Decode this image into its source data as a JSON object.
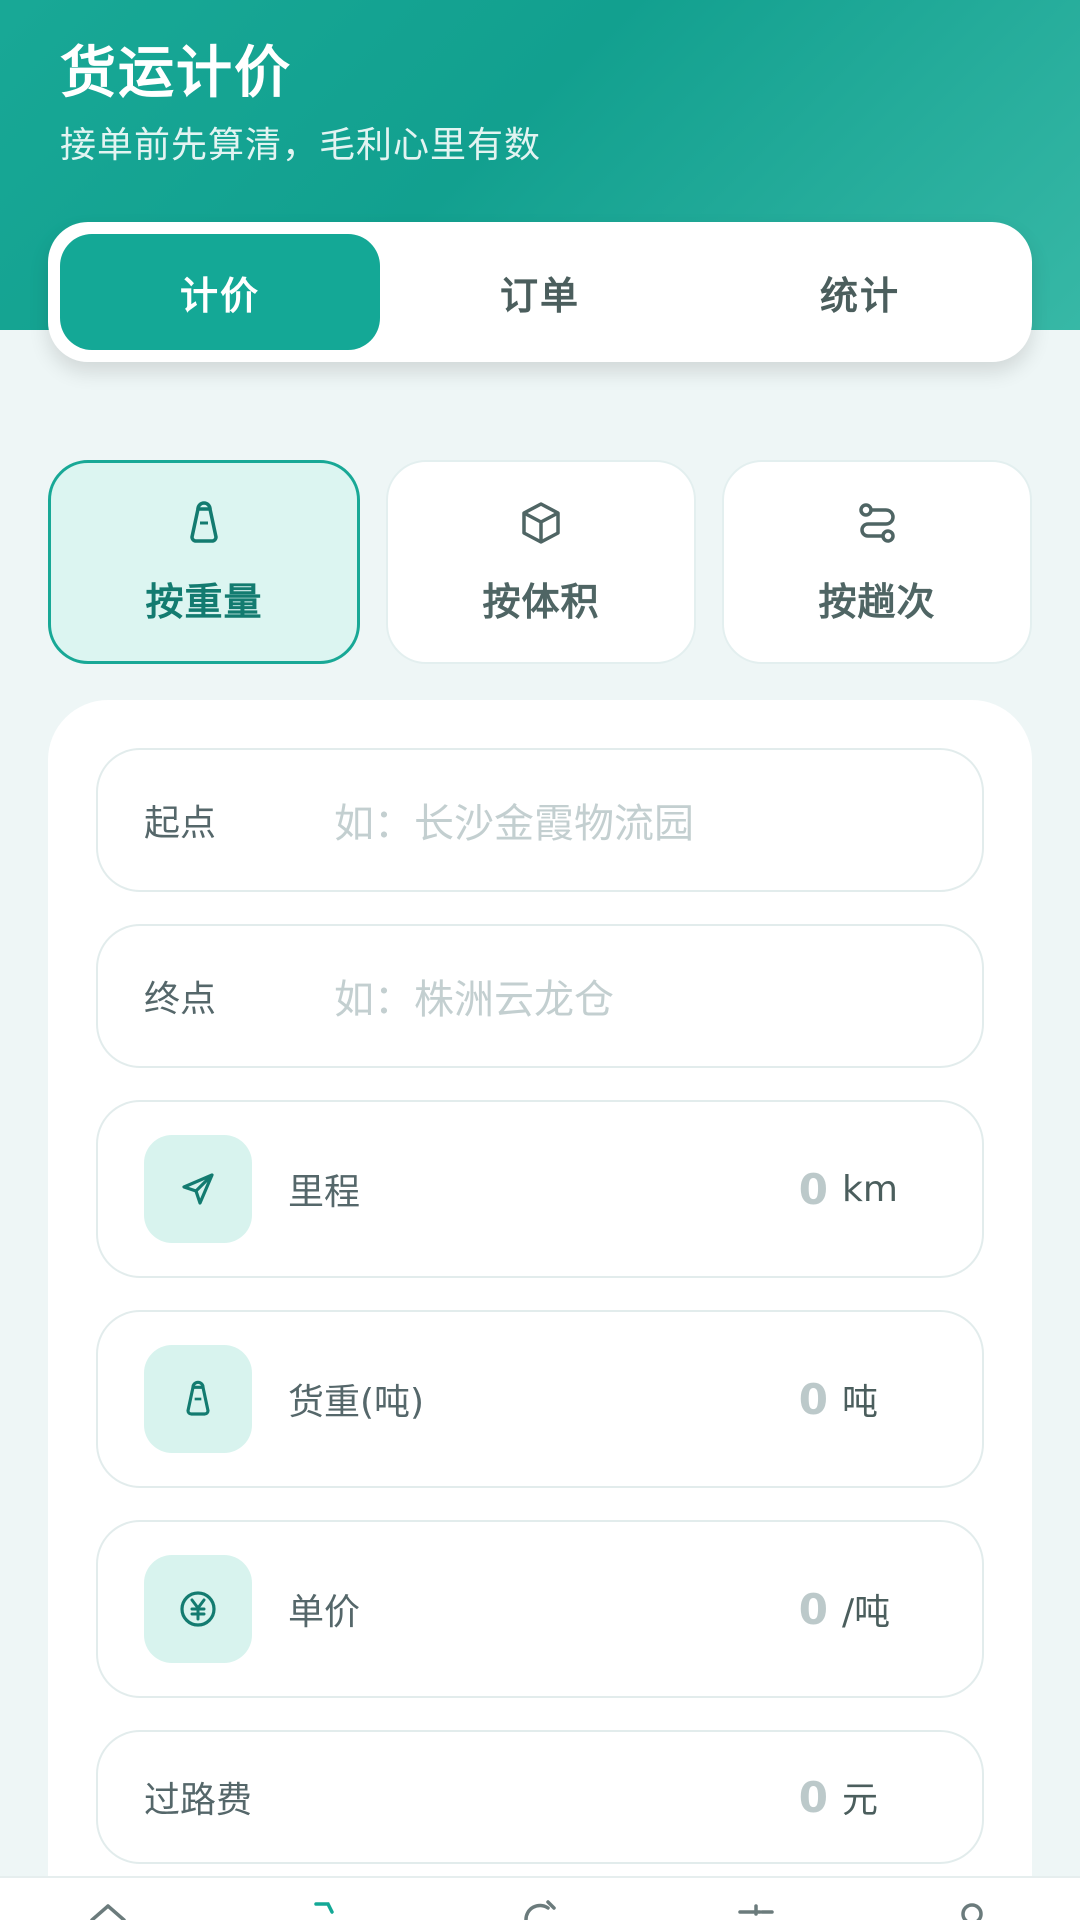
{
  "header": {
    "title": "货运计价",
    "subtitle": "接单前先算清，毛利心里有数"
  },
  "tabs": [
    {
      "label": "计价",
      "active": true
    },
    {
      "label": "订单",
      "active": false
    },
    {
      "label": "统计",
      "active": false
    }
  ],
  "modes": [
    {
      "label": "按重量",
      "icon": "weight-icon",
      "active": true
    },
    {
      "label": "按体积",
      "icon": "box-icon",
      "active": false
    },
    {
      "label": "按趟次",
      "icon": "route-icon",
      "active": false
    }
  ],
  "form": {
    "origin": {
      "label": "起点",
      "placeholder": "如：长沙金霞物流园"
    },
    "destination": {
      "label": "终点",
      "placeholder": "如：株洲云龙仓"
    },
    "distance": {
      "label": "里程",
      "value": "0",
      "unit": "km",
      "icon": "navigation-icon"
    },
    "weight": {
      "label": "货重(吨)",
      "value": "0",
      "unit": "吨",
      "icon": "weight-icon"
    },
    "unit_price": {
      "label": "单价",
      "value": "0",
      "unit": "/吨",
      "icon": "yuan-icon"
    },
    "toll": {
      "label": "过路费",
      "value": "0",
      "unit": "元"
    }
  },
  "bottom_nav": [
    "home-icon",
    "calculator-icon",
    "chart-icon",
    "truck-icon",
    "user-icon"
  ],
  "colors": {
    "primary": "#14a896",
    "primary_light": "#d8f3ee",
    "background": "#eef6f6",
    "text_muted": "#bcc9ca"
  }
}
